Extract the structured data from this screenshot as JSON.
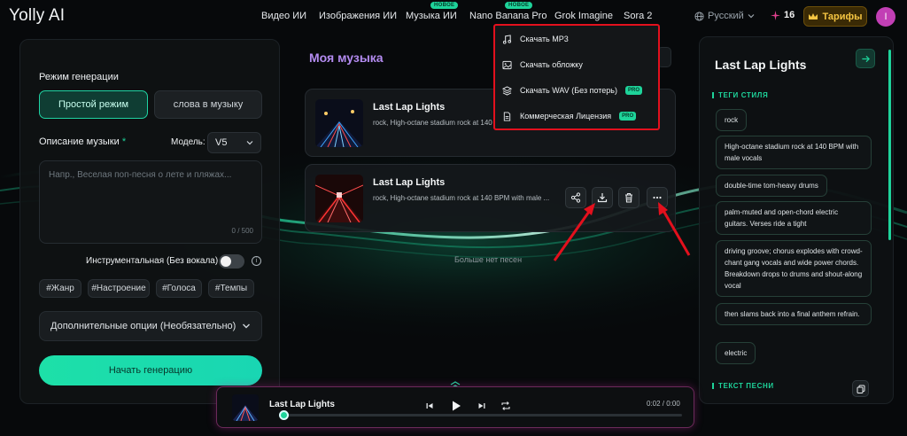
{
  "brand": {
    "logo": "Yolly AI"
  },
  "nav": {
    "items": [
      {
        "label": "Видео ИИ",
        "badge": ""
      },
      {
        "label": "Изображения ИИ",
        "badge": ""
      },
      {
        "label": "Музыка ИИ",
        "badge": "НОВОЕ"
      },
      {
        "label": "Nano Banana Pro",
        "badge": "НОВОЕ"
      },
      {
        "label": "Grok Imagine",
        "badge": ""
      },
      {
        "label": "Sora 2",
        "badge": ""
      }
    ],
    "language": "Русский",
    "credits": "16",
    "tariffs_label": "Тарифы",
    "avatar_letter": "I"
  },
  "generator": {
    "mode_label": "Режим генерации",
    "modes": [
      "Простой режим",
      "слова в музыку"
    ],
    "description_label": "Описание музыки",
    "required_mark": "*",
    "model_label": "Модель:",
    "model_value": "V5",
    "description_placeholder": "Напр., Веселая поп-песня о лете и пляжах...",
    "char_counter": "0 / 500",
    "instrumental_label": "Инструментальная (Без вокала)",
    "instrumental_on": false,
    "tags": [
      "#Жанр",
      "#Настроение",
      "#Голоса",
      "#Темпы"
    ],
    "extra_options_label": "Дополнительные опции (Необязательно)",
    "start_label": "Начать генерацию"
  },
  "my_music": {
    "title": "Моя музыка",
    "songs": [
      {
        "title": "Last Lap Lights",
        "subtitle": "rock, High-octane stadium rock at 140 BPM with male vocals"
      },
      {
        "title": "Last Lap Lights",
        "subtitle": "rock, High-octane stadium rock at 140 BPM with male ..."
      }
    ],
    "no_more_label": "Больше нет песен"
  },
  "download_menu": {
    "items": [
      {
        "label": "Скачать MP3",
        "icon": "music-note-icon",
        "pro": ""
      },
      {
        "label": "Скачать обложку",
        "icon": "image-icon",
        "pro": ""
      },
      {
        "label": "Скачать WAV (Без потерь)",
        "icon": "layers-icon",
        "pro": "PRO"
      },
      {
        "label": "Коммерческая Лицензия",
        "icon": "document-icon",
        "pro": "PRO"
      }
    ]
  },
  "details": {
    "title": "Last Lap Lights",
    "style_tags_header": "ТЕГИ СТИЛЯ",
    "style_tags": [
      "rock",
      "High-octane stadium rock at 140 BPM with male vocals",
      "double-time tom-heavy drums",
      "palm-muted and open-chord electric guitars. Verses ride a tight",
      "driving groove; chorus explodes with crowd-chant gang vocals and wide power chords. Breakdown drops to drums and shout-along vocal",
      "then slams back into a final anthem refrain.",
      "electric"
    ],
    "lyrics_header": "ТЕКСТ ПЕСНИ"
  },
  "player": {
    "title": "Last Lap Lights",
    "time": "0:02 / 0:00",
    "progress": 0.005
  },
  "colors": {
    "accent": "#1ED39A",
    "brand_purple": "#B38BF0",
    "annotation_red": "#E3101D",
    "gold": "#F5C542"
  }
}
